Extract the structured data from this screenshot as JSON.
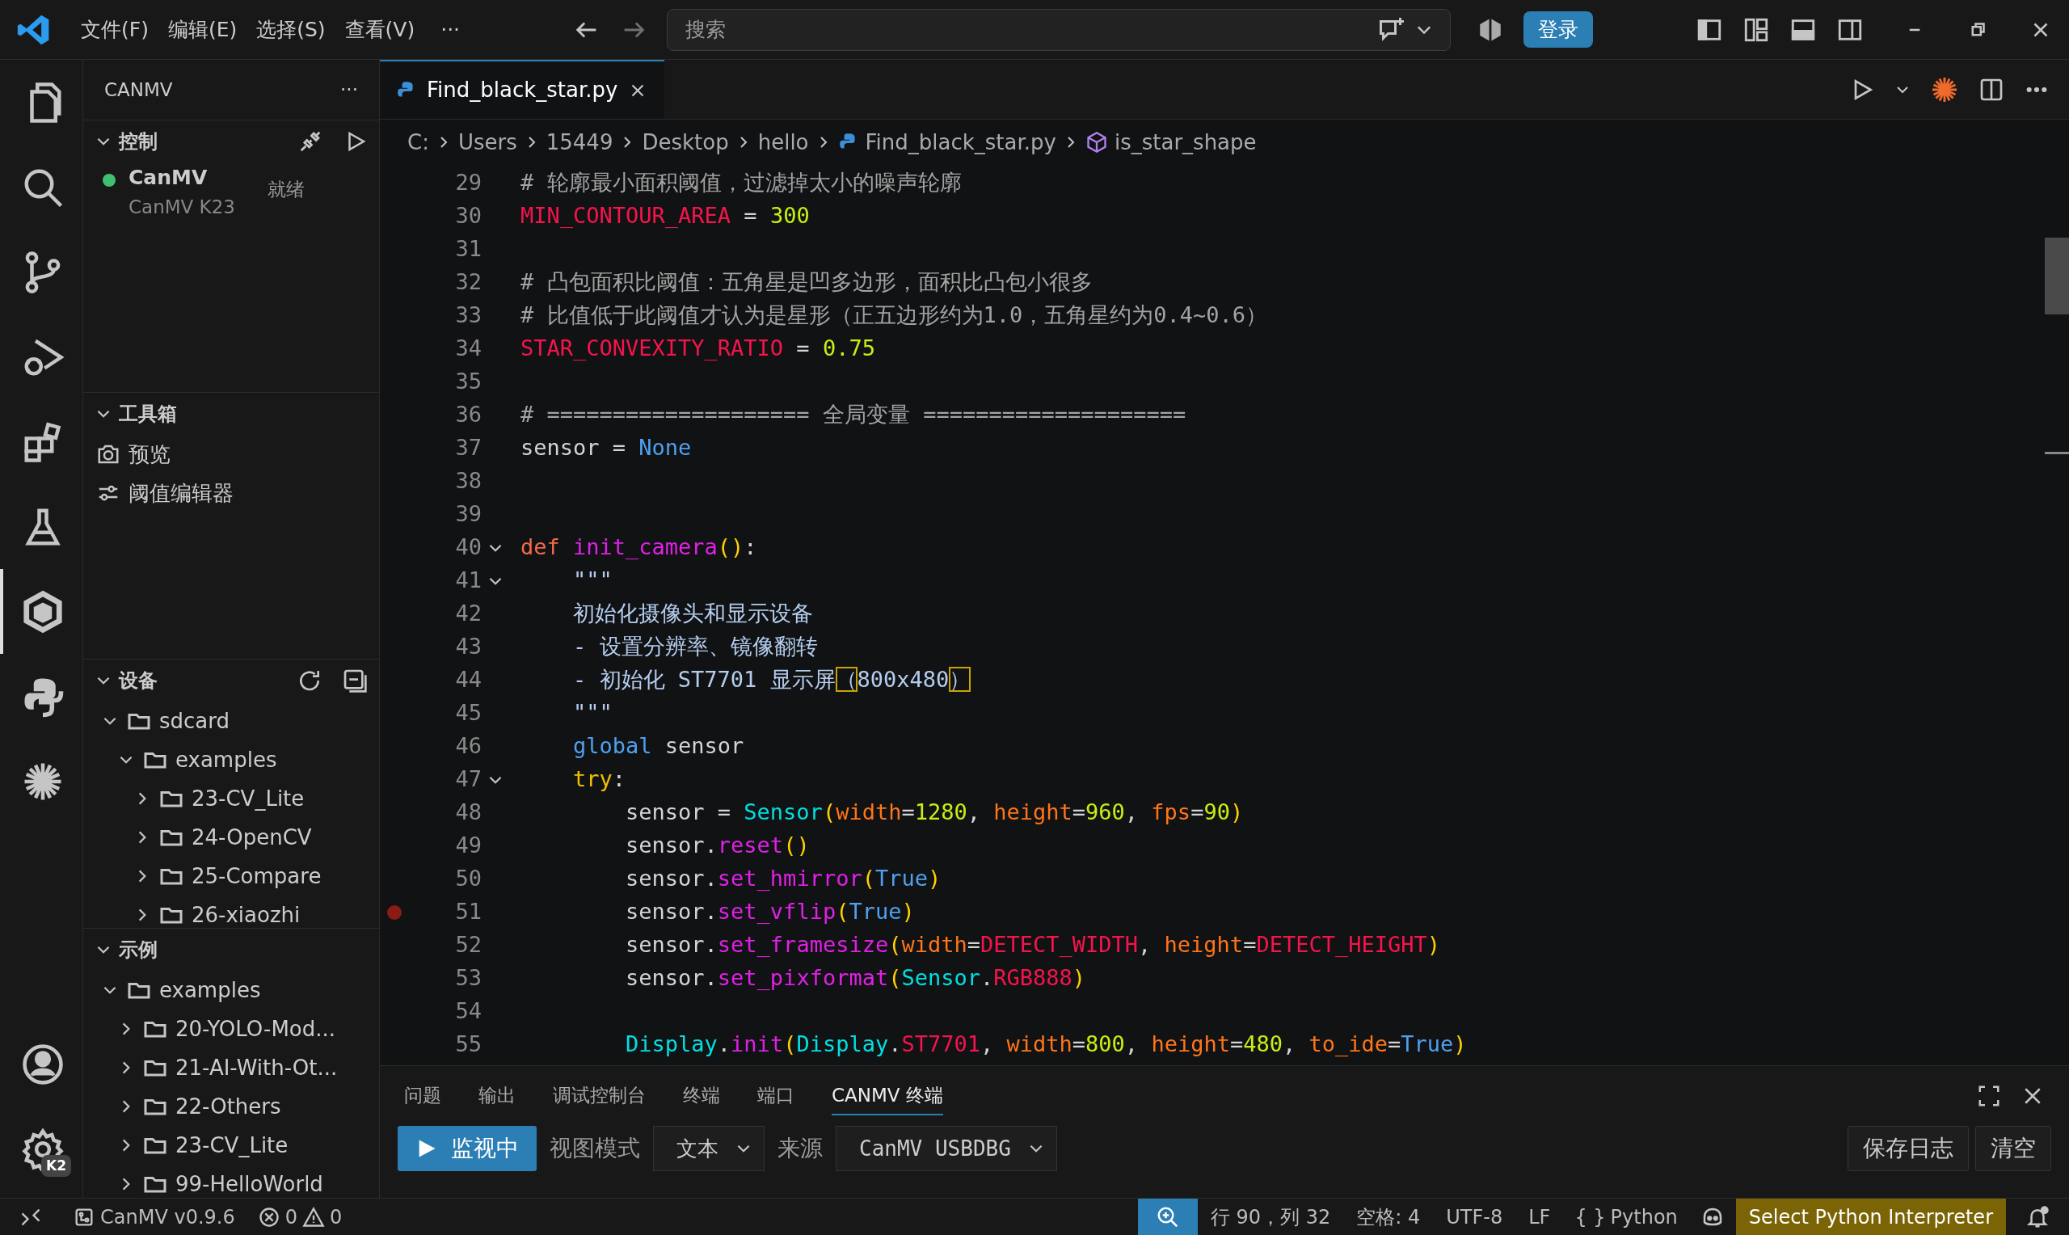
{
  "title_bar": {
    "menu": [
      "文件(F)",
      "编辑(E)",
      "选择(S)",
      "查看(V)"
    ],
    "more": "···",
    "search": {
      "placeholder": "搜索"
    },
    "login_button": "登录"
  },
  "activity_bar": {
    "items": [
      {
        "selected": false
      },
      {
        "selected": false
      },
      {
        "selected": false
      },
      {
        "selected": false
      },
      {
        "selected": false
      },
      {
        "selected": false
      },
      {
        "selected": true
      },
      {
        "selected": false
      },
      {
        "selected": false
      }
    ],
    "bottom_items": [
      {
        "selected": false
      },
      {
        "selected": false,
        "badge": "K2"
      }
    ]
  },
  "sidebar": {
    "title": "CANMV",
    "more": "···",
    "sections": [
      {
        "kind": "control",
        "title": "控制",
        "expanded": true,
        "devices": [
          {
            "name": "CanMV",
            "detail": "CanMV K23",
            "status": "就绪",
            "connected": true
          }
        ]
      },
      {
        "kind": "toolbox",
        "title": "工具箱",
        "expanded": true,
        "tools": [
          "预览",
          "阈值编辑器"
        ]
      },
      {
        "kind": "tree",
        "title": "设备",
        "expanded": true,
        "actions": true,
        "tree": [
          {
            "label": "sdcard",
            "expanded": true,
            "children": [
              {
                "label": "examples",
                "expanded": true,
                "children": [
                  {
                    "label": "23-CV_Lite",
                    "expanded": false
                  },
                  {
                    "label": "24-OpenCV",
                    "expanded": false
                  },
                  {
                    "label": "25-Compare",
                    "expanded": false
                  },
                  {
                    "label": "26-xiaozhi",
                    "expanded": false
                  }
                ]
              }
            ]
          }
        ]
      },
      {
        "kind": "tree",
        "title": "示例",
        "expanded": true,
        "actions": false,
        "tree": [
          {
            "label": "examples",
            "expanded": true,
            "children": [
              {
                "label": "20-YOLO-Mod...",
                "expanded": false
              },
              {
                "label": "21-AI-With-Ot...",
                "expanded": false
              },
              {
                "label": "22-Others",
                "expanded": false
              },
              {
                "label": "23-CV_Lite",
                "expanded": false
              },
              {
                "label": "99-HelloWorld",
                "expanded": false
              }
            ]
          }
        ]
      }
    ]
  },
  "editor": {
    "tabs": [
      {
        "label": "Find_black_star.py",
        "selected": true
      }
    ],
    "breadcrumbs": [
      {
        "label": "C:",
        "kind": "folder"
      },
      {
        "label": "Users",
        "kind": "folder"
      },
      {
        "label": "15449",
        "kind": "folder"
      },
      {
        "label": "Desktop",
        "kind": "folder"
      },
      {
        "label": "hello",
        "kind": "folder"
      },
      {
        "label": "Find_black_star.py",
        "kind": "file"
      },
      {
        "label": "is_star_shape",
        "kind": "symbol"
      }
    ],
    "lines": [
      {
        "number": "29",
        "tokens": [
          {
            "text": "# 轮廓最小面积阈值，过滤掉太小的噪声轮廓",
            "kind": "comment"
          }
        ]
      },
      {
        "number": "30",
        "tokens": [
          {
            "text": "MIN_CONTOUR_AREA",
            "kind": "constant"
          },
          {
            "text": " = ",
            "kind": "plain"
          },
          {
            "text": "300",
            "kind": "number"
          }
        ]
      },
      {
        "number": "31"
      },
      {
        "number": "32",
        "tokens": [
          {
            "text": "# 凸包面积比阈值：五角星是凹多边形，面积比凸包小很多",
            "kind": "comment"
          }
        ]
      },
      {
        "number": "33",
        "tokens": [
          {
            "text": "# 比值低于此阈值才认为是星形（正五边形约为1.0，五角星约为0.4~0.6）",
            "kind": "comment"
          }
        ]
      },
      {
        "number": "34",
        "tokens": [
          {
            "text": "STAR_CONVEXITY_RATIO",
            "kind": "constant"
          },
          {
            "text": " = ",
            "kind": "plain"
          },
          {
            "text": "0.75",
            "kind": "number"
          }
        ]
      },
      {
        "number": "35"
      },
      {
        "number": "36",
        "tokens": [
          {
            "text": "# ==================== 全局变量 ====================",
            "kind": "comment"
          }
        ]
      },
      {
        "number": "37",
        "tokens": [
          {
            "text": "sensor = ",
            "kind": "plain"
          },
          {
            "text": "None",
            "kind": "builtin"
          }
        ]
      },
      {
        "number": "38"
      },
      {
        "number": "39"
      },
      {
        "number": "40",
        "folding": true,
        "tokens": [
          {
            "text": "def ",
            "kind": "def"
          },
          {
            "text": "init_camera",
            "kind": "function"
          },
          {
            "text": "()",
            "kind": "paren"
          },
          {
            "text": ":",
            "kind": "plain"
          }
        ]
      },
      {
        "number": "41",
        "folding": true,
        "tokens": [
          {
            "text": "    \"\"\"",
            "kind": "docstring"
          }
        ]
      },
      {
        "number": "42",
        "tokens": [
          {
            "text": "    初始化摄像头和显示设备",
            "kind": "docstring"
          }
        ]
      },
      {
        "number": "43",
        "tokens": [
          {
            "text": "    - 设置分辨率、镜像翻转",
            "kind": "docstring"
          }
        ]
      },
      {
        "number": "44",
        "tokens": [
          {
            "text": "    - 初始化 ST7701 显示屏",
            "kind": "docstring"
          },
          {
            "text": "（",
            "kind": "bracket"
          },
          {
            "text": "800x480",
            "kind": "docstring"
          },
          {
            "text": "）",
            "kind": "bracket"
          }
        ]
      },
      {
        "number": "45",
        "tokens": [
          {
            "text": "    \"\"\"",
            "kind": "docstring"
          }
        ]
      },
      {
        "number": "46",
        "tokens": [
          {
            "text": "    global",
            "kind": "builtin"
          },
          {
            "text": " sensor",
            "kind": "plain"
          }
        ]
      },
      {
        "number": "47",
        "folding": true,
        "tokens": [
          {
            "text": "    try",
            "kind": "keyword"
          },
          {
            "text": ":",
            "kind": "plain"
          }
        ]
      },
      {
        "number": "48",
        "tokens": [
          {
            "text": "        sensor = ",
            "kind": "plain"
          },
          {
            "text": "Sensor",
            "kind": "class"
          },
          {
            "text": "(",
            "kind": "paren"
          },
          {
            "text": "width",
            "kind": "parameter"
          },
          {
            "text": "=",
            "kind": "plain"
          },
          {
            "text": "1280",
            "kind": "number"
          },
          {
            "text": ", ",
            "kind": "plain"
          },
          {
            "text": "height",
            "kind": "parameter"
          },
          {
            "text": "=",
            "kind": "plain"
          },
          {
            "text": "960",
            "kind": "number"
          },
          {
            "text": ", ",
            "kind": "plain"
          },
          {
            "text": "fps",
            "kind": "parameter"
          },
          {
            "text": "=",
            "kind": "plain"
          },
          {
            "text": "90",
            "kind": "number"
          },
          {
            "text": ")",
            "kind": "paren"
          }
        ]
      },
      {
        "number": "49",
        "tokens": [
          {
            "text": "        sensor.",
            "kind": "plain"
          },
          {
            "text": "reset",
            "kind": "function"
          },
          {
            "text": "()",
            "kind": "paren"
          }
        ]
      },
      {
        "number": "50",
        "tokens": [
          {
            "text": "        sensor.",
            "kind": "plain"
          },
          {
            "text": "set_hmirror",
            "kind": "function"
          },
          {
            "text": "(",
            "kind": "paren"
          },
          {
            "text": "True",
            "kind": "builtin"
          },
          {
            "text": ")",
            "kind": "paren"
          }
        ]
      },
      {
        "number": "51",
        "breakpoint": true,
        "tokens": [
          {
            "text": "        sensor.",
            "kind": "plain"
          },
          {
            "text": "set_vflip",
            "kind": "function"
          },
          {
            "text": "(",
            "kind": "paren"
          },
          {
            "text": "True",
            "kind": "builtin"
          },
          {
            "text": ")",
            "kind": "paren"
          }
        ]
      },
      {
        "number": "52",
        "tokens": [
          {
            "text": "        sensor.",
            "kind": "plain"
          },
          {
            "text": "set_framesize",
            "kind": "function"
          },
          {
            "text": "(",
            "kind": "paren"
          },
          {
            "text": "width",
            "kind": "parameter"
          },
          {
            "text": "=",
            "kind": "plain"
          },
          {
            "text": "DETECT_WIDTH",
            "kind": "constant"
          },
          {
            "text": ", ",
            "kind": "plain"
          },
          {
            "text": "height",
            "kind": "parameter"
          },
          {
            "text": "=",
            "kind": "plain"
          },
          {
            "text": "DETECT_HEIGHT",
            "kind": "constant"
          },
          {
            "text": ")",
            "kind": "paren"
          }
        ]
      },
      {
        "number": "53",
        "tokens": [
          {
            "text": "        sensor.",
            "kind": "plain"
          },
          {
            "text": "set_pixformat",
            "kind": "function"
          },
          {
            "text": "(",
            "kind": "paren"
          },
          {
            "text": "Sensor",
            "kind": "class"
          },
          {
            "text": ".",
            "kind": "plain"
          },
          {
            "text": "RGB888",
            "kind": "constant"
          },
          {
            "text": ")",
            "kind": "paren"
          }
        ]
      },
      {
        "number": "54"
      },
      {
        "number": "55",
        "tokens": [
          {
            "text": "        Display",
            "kind": "class"
          },
          {
            "text": ".",
            "kind": "plain"
          },
          {
            "text": "init",
            "kind": "function"
          },
          {
            "text": "(",
            "kind": "paren"
          },
          {
            "text": "Display",
            "kind": "class"
          },
          {
            "text": ".",
            "kind": "plain"
          },
          {
            "text": "ST7701",
            "kind": "constant"
          },
          {
            "text": ", ",
            "kind": "plain"
          },
          {
            "text": "width",
            "kind": "parameter"
          },
          {
            "text": "=",
            "kind": "plain"
          },
          {
            "text": "800",
            "kind": "number"
          },
          {
            "text": ", ",
            "kind": "plain"
          },
          {
            "text": "height",
            "kind": "parameter"
          },
          {
            "text": "=",
            "kind": "plain"
          },
          {
            "text": "480",
            "kind": "number"
          },
          {
            "text": ", ",
            "kind": "plain"
          },
          {
            "text": "to_ide",
            "kind": "parameter"
          },
          {
            "text": "=",
            "kind": "plain"
          },
          {
            "text": "True",
            "kind": "builtin"
          },
          {
            "text": ")",
            "kind": "paren"
          }
        ]
      }
    ]
  },
  "panel": {
    "tabs": [
      {
        "label": "问题",
        "selected": false
      },
      {
        "label": "输出",
        "selected": false
      },
      {
        "label": "调试控制台",
        "selected": false
      },
      {
        "label": "终端",
        "selected": false
      },
      {
        "label": "端口",
        "selected": false
      },
      {
        "label": "CANMV 终端",
        "selected": true
      }
    ],
    "monitor_button": "监视中",
    "view_mode_label": "视图模式",
    "view_mode": "文本",
    "source_label": "来源",
    "source": "CanMV USBDBG",
    "save_button": "保存日志",
    "clear_button": "清空"
  },
  "status_bar": {
    "version": "CanMV v0.9.6",
    "errors": "0",
    "warnings": "0",
    "position": "行 90，列 32",
    "indent": "空格: 4",
    "encoding": "UTF-8",
    "eol": "LF",
    "language_icon": "{ }",
    "language": "Python",
    "interpreter": "Select Python Interpreter"
  }
}
